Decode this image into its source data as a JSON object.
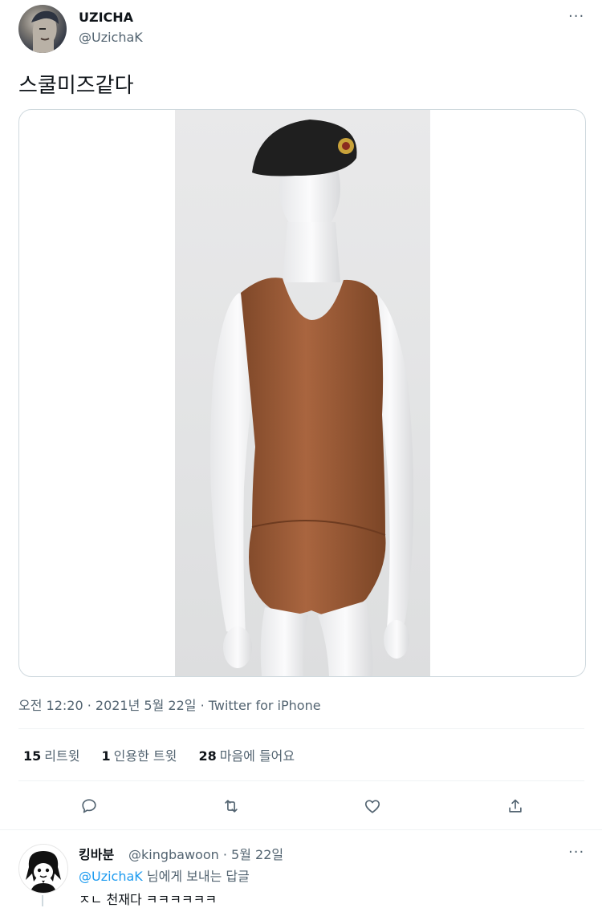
{
  "tweet": {
    "display_name": "UZICHA",
    "handle": "@UzichaK",
    "text": "스쿨미즈같다",
    "timestamp": "오전 12:20 · 2021년 5월 22일 · ",
    "source": "Twitter for iPhone",
    "stats": {
      "retweets_count": "15",
      "retweets_label": "리트윗",
      "quotes_count": "1",
      "quotes_label": "인용한 트윗",
      "likes_count": "28",
      "likes_label": "마음에 들어요"
    },
    "more_glyph": "···"
  },
  "actions": [
    {
      "name": "reply",
      "icon": "reply-icon"
    },
    {
      "name": "retweet",
      "icon": "retweet-icon"
    },
    {
      "name": "like",
      "icon": "heart-icon"
    },
    {
      "name": "share",
      "icon": "share-icon"
    }
  ],
  "reply": {
    "display_name": "킹바분",
    "handle_date": "@kingbawoon · 5월 22일",
    "mention": "@UzichaK",
    "to_suffix": " 님에게 보내는 답글",
    "text": "ㅈㄴ 천재다 ㅋㅋㅋㅋㅋㅋ",
    "more_glyph": "···"
  },
  "colors": {
    "text_primary": "#0f1419",
    "text_secondary": "#536471",
    "link": "#1d9bf0",
    "border": "#cfd9de",
    "divider": "#eff3f4",
    "shirt": "#9a5a38",
    "beret": "#1f1f1f"
  }
}
